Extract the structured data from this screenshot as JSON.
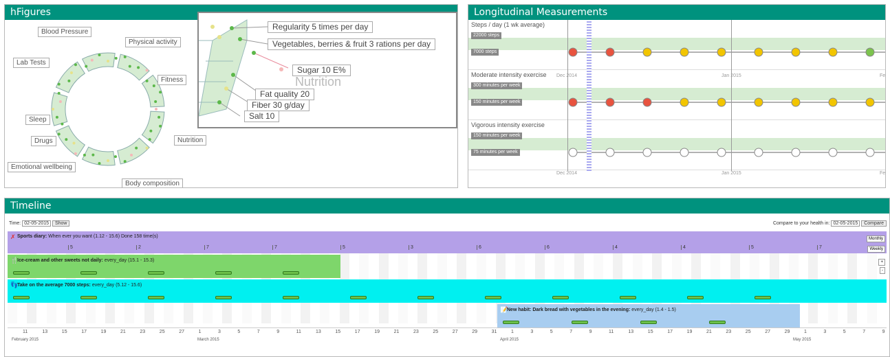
{
  "hfigures": {
    "title": "hFigures",
    "labels": [
      "Blood Pressure",
      "Physical activity",
      "Lab Tests",
      "Fitness",
      "Sleep",
      "Nutrition",
      "Drugs",
      "Emotional wellbeing",
      "Body composition"
    ],
    "zoom": {
      "title": "Nutrition",
      "items": [
        "Regularity 5 times per day",
        "Vegetables, berries & fruit 3 rations per day",
        "Sugar 10 E%",
        "Fat quality 20",
        "Fiber 30 g/day",
        "Salt 10"
      ]
    }
  },
  "longitudinal": {
    "title": "Longitudinal Measurements",
    "rows": [
      {
        "title": "Steps / day (1 wk average)",
        "upper": "22000 steps",
        "lower": "7000 steps",
        "colors": [
          "#e8533f",
          "#e8533f",
          "#f2c500",
          "#f2c500",
          "#f2c500",
          "#f2c500",
          "#f2c500",
          "#f2c500",
          "#7cc34e",
          "#f2c500"
        ]
      },
      {
        "title": "Moderate intensity exercise",
        "upper": "300 minutes per week",
        "lower": "150 minutes per week",
        "colors": [
          "#e8533f",
          "#e8533f",
          "#e8533f",
          "#f2c500",
          "#f2c500",
          "#f2c500",
          "#f2c500",
          "#f2c500",
          "#f2c500",
          "#f2c500"
        ]
      },
      {
        "title": "Vigorous intensity exercise",
        "upper": "150 minutes per week",
        "lower": "75 minutes per week",
        "colors": [
          "#ffffff",
          "#ffffff",
          "#ffffff",
          "#ffffff",
          "#ffffff",
          "#ffffff",
          "#ffffff",
          "#ffffff",
          "#ffffff",
          "#ffffff"
        ]
      }
    ],
    "dates": [
      "Dec 2014",
      "Jan 2015",
      "Fe"
    ]
  },
  "timeline": {
    "title": "Timeline",
    "time_label": "Time:",
    "time_value": "02-05-2015",
    "show_label": "Show",
    "compare_label": "Compare to your health in:",
    "compare_value": "02-05-2015",
    "compare_btn": "Compare",
    "monthly": "Monthly",
    "weekly": "Weekly",
    "plus": "+",
    "minus": "-",
    "lanes": [
      {
        "title": "Sports diary:",
        "detail": "When ever you want (1.12 - 15.6) Done 158 time(s)",
        "counts": [
          "5",
          "2",
          "7",
          "7",
          "5",
          "3",
          "6",
          "6",
          "4",
          "4",
          "5",
          "7"
        ]
      },
      {
        "title": "Ice-cream and other sweets not daily:",
        "detail": "every_day (15.1 - 15.3)"
      },
      {
        "title": "Take on the average 7000 steps:",
        "detail": "every_day (5.12 - 15.6)"
      },
      {
        "title": "New habit: Dark bread with vegetables in the evening:",
        "detail": "every_day (1.4 - 1.5)"
      }
    ],
    "days": [
      "11",
      "13",
      "15",
      "17",
      "19",
      "21",
      "23",
      "25",
      "27",
      "1",
      "3",
      "5",
      "7",
      "9",
      "11",
      "13",
      "15",
      "17",
      "19",
      "21",
      "23",
      "25",
      "27",
      "29",
      "31",
      "1",
      "3",
      "5",
      "7",
      "9",
      "11",
      "13",
      "15",
      "17",
      "19",
      "21",
      "23",
      "25",
      "27",
      "29",
      "1",
      "3",
      "5",
      "7",
      "9"
    ],
    "months": [
      "February 2015",
      "March 2015",
      "April 2015",
      "May 2015"
    ]
  }
}
